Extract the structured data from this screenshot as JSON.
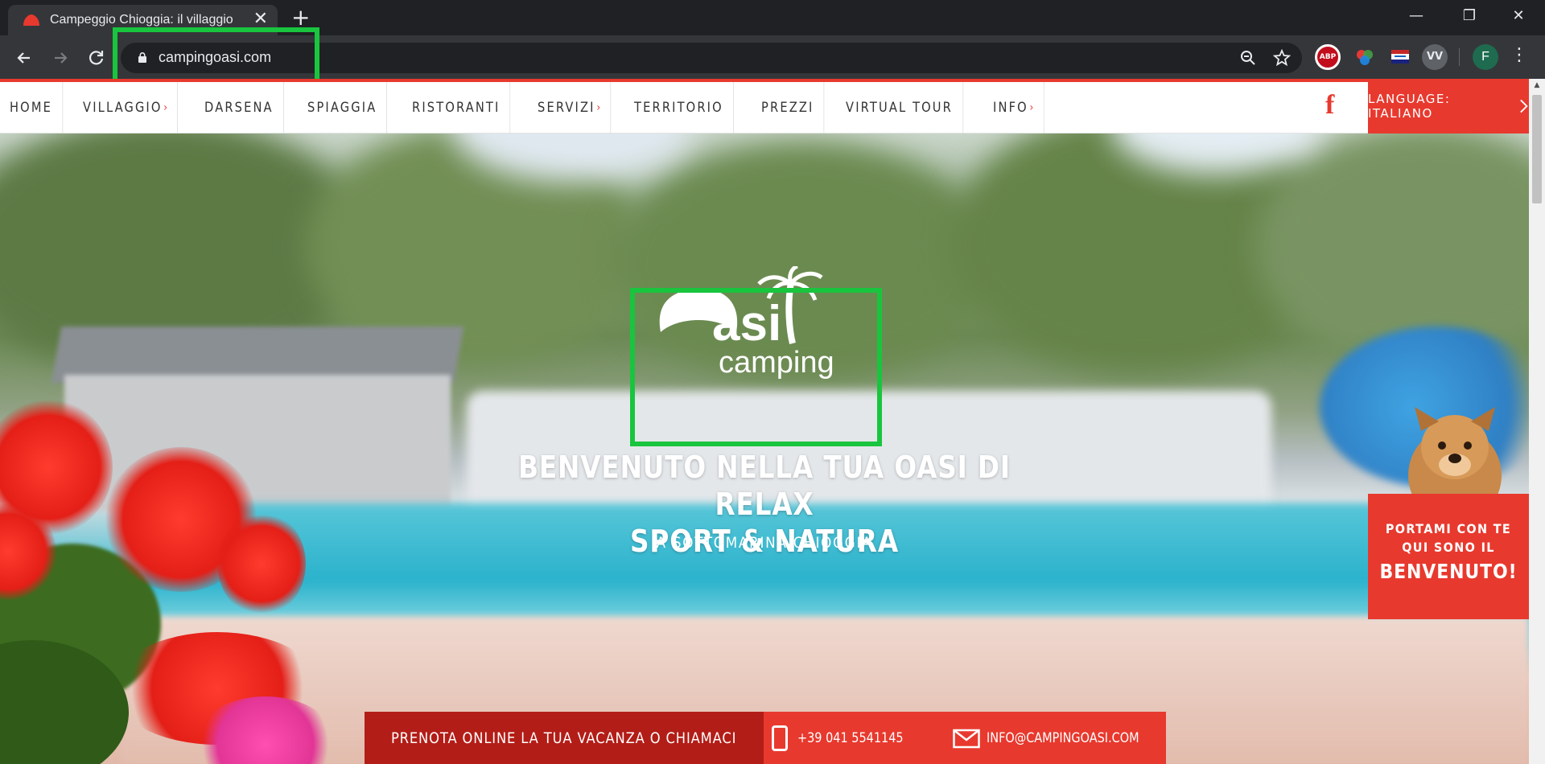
{
  "browser": {
    "tab_title": "Campeggio Chioggia: il villaggio",
    "tab_close": "✕",
    "new_tab": "+",
    "url": "campingoasi.com",
    "avatar_letter": "F",
    "ext_abp": "ABP",
    "ext_vv": "VV",
    "controls": {
      "minimize": "—",
      "maximize": "❐",
      "close": "✕"
    }
  },
  "site": {
    "menu": [
      {
        "label": "HOME",
        "has_sub": false
      },
      {
        "label": "VILLAGGIO",
        "has_sub": true
      },
      {
        "label": "DARSENA",
        "has_sub": false
      },
      {
        "label": "SPIAGGIA",
        "has_sub": false
      },
      {
        "label": "RISTORANTI",
        "has_sub": false
      },
      {
        "label": "SERVIZI",
        "has_sub": true
      },
      {
        "label": "TERRITORIO",
        "has_sub": false
      },
      {
        "label": "PREZZI",
        "has_sub": false
      },
      {
        "label": "VIRTUAL TOUR",
        "has_sub": false
      },
      {
        "label": "INFO",
        "has_sub": true
      }
    ],
    "facebook_icon": "f",
    "language_button": "LANGUAGE: ITALIANO",
    "logo_text_1": "asi",
    "logo_text_2": "camping",
    "headline_1": "BENVENUTO NELLA TUA OASI DI RELAX",
    "headline_2": "SPORT & NATURA",
    "subline": "A SOTTOMARINA CHIOGGIA",
    "pets": {
      "line1": "PORTAMI CON TE",
      "line2": "QUI SONO IL",
      "line3": "BENVENUTO!"
    },
    "cta": {
      "book": "PRENOTA ONLINE LA TUA VACANZA O CHIAMACI",
      "phone": "+39 041 5541145",
      "email": "INFO@CAMPINGOASI.COM"
    }
  },
  "colors": {
    "accent": "#e8392e",
    "accent_dark": "#b31d17",
    "highlight": "#19c53e",
    "chrome": "#35363a"
  }
}
